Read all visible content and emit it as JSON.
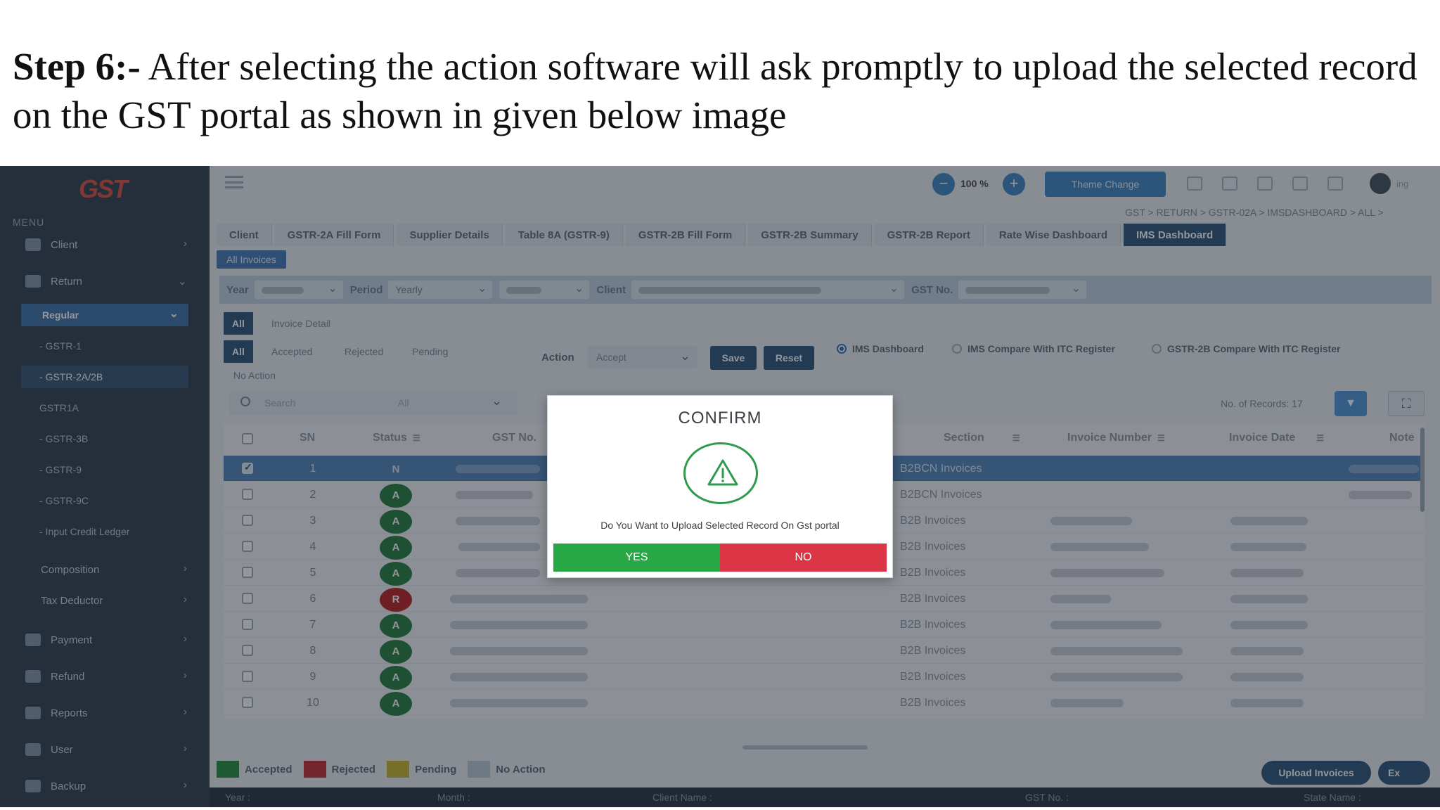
{
  "caption": {
    "step": "Step 6:-",
    "text": " After selecting the action software will ask promptly to upload the selected record on the GST portal as shown in given below image"
  },
  "app": {
    "logo": "GST",
    "sidebar": {
      "menu_title": "MENU",
      "items": [
        {
          "label": "Client"
        },
        {
          "label": "Return"
        },
        {
          "label": "Regular"
        },
        {
          "label": "- GSTR-1"
        },
        {
          "label": "- GSTR-2A/2B"
        },
        {
          "label": "GSTR1A"
        },
        {
          "label": "- GSTR-3B"
        },
        {
          "label": "- GSTR-9"
        },
        {
          "label": "- GSTR-9C"
        },
        {
          "label": "- Input Credit Ledger"
        },
        {
          "label": "Composition"
        },
        {
          "label": "Tax Deductor"
        },
        {
          "label": "Payment"
        },
        {
          "label": "Refund"
        },
        {
          "label": "Reports"
        },
        {
          "label": "User"
        },
        {
          "label": "Backup"
        }
      ]
    },
    "topbar": {
      "zoom": "100 %",
      "zoom_minus": "−",
      "zoom_plus": "+",
      "theme_button": "Theme Change",
      "user": "ing"
    },
    "breadcrumb": "GST > RETURN > GSTR-02A > IMSDASHBOARD > ALL >",
    "tabs": [
      {
        "label": "Client"
      },
      {
        "label": "GSTR-2A Fill Form"
      },
      {
        "label": "Supplier Details"
      },
      {
        "label": "Table 8A (GSTR-9)"
      },
      {
        "label": "GSTR-2B Fill Form"
      },
      {
        "label": "GSTR-2B Summary"
      },
      {
        "label": "GSTR-2B Report"
      },
      {
        "label": "Rate Wise Dashboard"
      },
      {
        "label": "IMS Dashboard"
      }
    ],
    "subtab": "All Invoices",
    "filters": {
      "year_label": "Year",
      "period_label": "Period",
      "period_value": "Yearly",
      "client_label": "Client",
      "gst_label": "GST No."
    },
    "row1": {
      "all": "All",
      "invoice_detail": "Invoice Detail"
    },
    "row2": {
      "all": "All",
      "accepted": "Accepted",
      "rejected": "Rejected",
      "pending": "Pending",
      "no_action": "No Action"
    },
    "action": {
      "label": "Action",
      "value": "Accept",
      "save": "Save",
      "reset": "Reset"
    },
    "radios": [
      {
        "label": "IMS Dashboard"
      },
      {
        "label": "IMS Compare With ITC Register"
      },
      {
        "label": "GSTR-2B Compare With ITC Register"
      }
    ],
    "search": {
      "placeholder": "Search",
      "filter_value": "All"
    },
    "records": "No. of Records: 17",
    "table": {
      "headers": {
        "sn": "SN",
        "status": "Status",
        "gst": "GST No.",
        "section": "Section",
        "invoice_number": "Invoice Number",
        "invoice_date": "Invoice Date",
        "note": "Note"
      },
      "rows": [
        {
          "sn": "1",
          "status": "N",
          "section": "B2BCN Invoices"
        },
        {
          "sn": "2",
          "status": "A",
          "section": "B2BCN Invoices"
        },
        {
          "sn": "3",
          "status": "A",
          "section": "B2B Invoices"
        },
        {
          "sn": "4",
          "status": "A",
          "section": "B2B Invoices"
        },
        {
          "sn": "5",
          "status": "A",
          "section": "B2B Invoices"
        },
        {
          "sn": "6",
          "status": "R",
          "section": "B2B Invoices"
        },
        {
          "sn": "7",
          "status": "A",
          "section": "B2B Invoices"
        },
        {
          "sn": "8",
          "status": "A",
          "section": "B2B Invoices"
        },
        {
          "sn": "9",
          "status": "A",
          "section": "B2B Invoices"
        },
        {
          "sn": "10",
          "status": "A",
          "section": "B2B Invoices"
        }
      ]
    },
    "legend": [
      {
        "label": "Accepted",
        "color": "#1f8a3c"
      },
      {
        "label": "Rejected",
        "color": "#c0272d"
      },
      {
        "label": "Pending",
        "color": "#c9b52c"
      },
      {
        "label": "No Action",
        "color": "#b8c7d4"
      }
    ],
    "buttons": {
      "upload": "Upload Invoices",
      "export": "Ex"
    },
    "footer": {
      "year": "Year :",
      "month": "Month :",
      "client_name": "Client Name :",
      "gst_no": "GST No. :",
      "state_name": "State Name :"
    }
  },
  "modal": {
    "title": "CONFIRM",
    "message": "Do You Want to Upload Selected Record On Gst portal",
    "yes": "YES",
    "no": "NO"
  }
}
